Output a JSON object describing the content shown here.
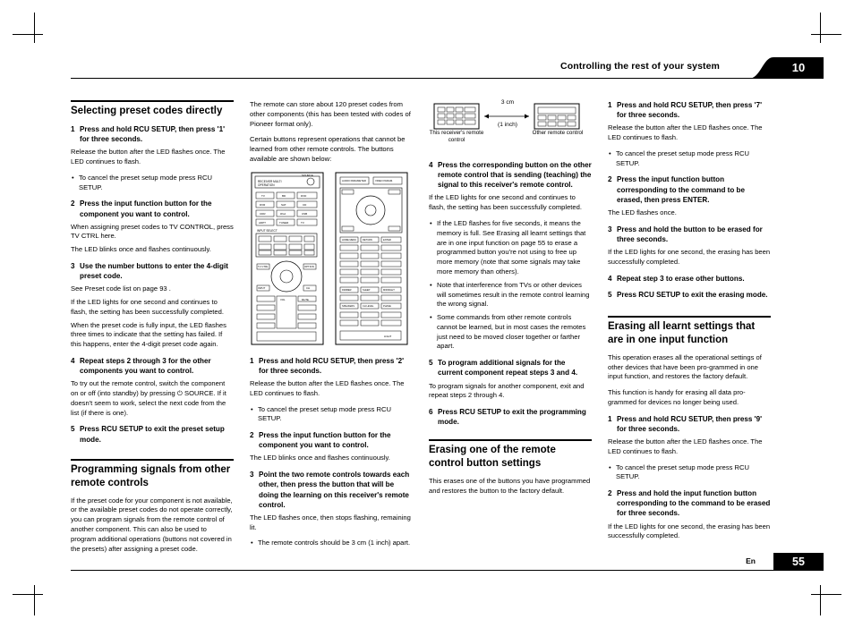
{
  "header": {
    "title": "Controlling the rest of your system",
    "chapter": "10"
  },
  "footer": {
    "lang": "En",
    "page": "55"
  },
  "col1": {
    "heading1": "Selecting preset codes directly",
    "step1_num": "1",
    "step1_text": "Press and hold RCU SETUP, then press '1' for three seconds.",
    "p1": "Release the button after the LED flashes once. The LED continues to flash.",
    "b1": "To cancel the preset setup mode press RCU SETUP.",
    "step2_num": "2",
    "step2_text": "Press the input function button for the component you want to control.",
    "p2": "When assigning preset codes to TV CONTROL, press TV CTRL here.",
    "p3": "The LED blinks once and flashes continuously.",
    "step3_num": "3",
    "step3_text": "Use the number buttons to enter the 4-digit preset code.",
    "p4": "See Preset code list on page 93 .",
    "p5": "If the LED lights for one second and continues to flash, the setting has been successfully completed.",
    "p6": "When the preset code is fully input, the LED flashes three times to indicate that the setting has failed. If this happens, enter the 4-digit preset code again.",
    "step4_num": "4",
    "step4_text": "Repeat steps 2 through 3 for the other components you want to control.",
    "p7": "To try out the remote control, switch the component on or off (into standby) by pressing ⏻ SOURCE. If it doesn't seem to work, select the next code from the list (if there is one).",
    "step5_num": "5",
    "step5_text": "Press RCU SETUP to exit the preset setup mode.",
    "heading2": "Programming signals from other remote controls",
    "p8": "If the preset code for your component is not available, or the available preset codes do not operate correctly, you can program signals from the remote control of another component. This can also be used to program additional operations (buttons not covered in the presets) after assigning a preset code."
  },
  "col2": {
    "p1": "The remote can store about 120 preset codes from other components (this has been tested with codes of Pioneer format only).",
    "p2": "Certain buttons represent operations that cannot be learned from other remote controls. The buttons available are shown below:",
    "step1_num": "1",
    "step1_text": "Press and hold RCU SETUP, then press '2' for three seconds.",
    "p3": "Release the button after the LED flashes once. The LED continues to flash.",
    "b1": "To cancel the preset setup mode press RCU SETUP.",
    "step2_num": "2",
    "step2_text": "Press the input function button for the component you want to control.",
    "p4": "The LED blinks once and flashes continuously.",
    "step3_num": "3",
    "step3_text": "Point the two remote controls towards each other, then press the button that will be doing the learning on this receiver's remote control.",
    "p5": "The LED flashes once, then stops flashing, remaining lit.",
    "b2": "The remote controls should be 3 cm (1 inch) apart."
  },
  "col3": {
    "fig_left_caption": "This receiver's remote control",
    "fig_dim_top": "3 cm",
    "fig_dim_bottom": "(1 inch)",
    "fig_right_caption": "Other remote control",
    "step4_num": "4",
    "step4_text": "Press the corresponding button on the other remote control that is sending (teaching) the signal to this receiver's remote control.",
    "p1": "If the LED lights for one second and continues to flash, the setting has been successfully completed.",
    "b1": "If the LED flashes for five seconds, it means the memory is full. See Erasing all learnt settings that are in one input function on page 55 to erase a programmed button you're not using to free up more memory (note that some signals may take more memory than others).",
    "b2": "Note that interference from TVs or other devices will sometimes result in the remote control learning the wrong signal.",
    "b3": "Some commands from other remote controls cannot be learned, but in most cases the remotes just need to be moved closer together or farther apart.",
    "step5_num": "5",
    "step5_text": "To program additional signals for the current component repeat steps 3 and 4.",
    "p2": "To program signals for another component, exit and repeat steps 2 through 4.",
    "step6_num": "6",
    "step6_text": "Press RCU SETUP to exit the programming mode.",
    "heading1": "Erasing one of the remote control button settings",
    "p3": "This erases one of the buttons you have programmed and restores the button to the factory default."
  },
  "col4": {
    "step1_num": "1",
    "step1_text": "Press and hold RCU SETUP, then press '7' for three seconds.",
    "p1": "Release the button after the LED flashes once. The LED continues to flash.",
    "b1": "To cancel the preset setup mode press RCU SETUP.",
    "step2_num": "2",
    "step2_text": "Press the input function button corresponding to the command to be erased, then press ENTER.",
    "p2": "The LED flashes once.",
    "step3_num": "3",
    "step3_text": "Press and hold the button to be erased for three seconds.",
    "p3": "If the LED lights for one second, the erasing has been successfully completed.",
    "step4_num": "4",
    "step4_text": "Repeat step 3 to erase other buttons.",
    "step5_num": "5",
    "step5_text": "Press RCU SETUP to exit the erasing mode.",
    "heading1": "Erasing all learnt settings that are in one input function",
    "p4": "This operation erases all the operational settings of other devices that have been pro-grammed in one input function, and restores the factory default.",
    "p5": "This function is handy for erasing all data pro-grammed for devices no longer being used.",
    "step6_num": "1",
    "step6_text": "Press and hold RCU SETUP, then press '9' for three seconds.",
    "p6": "Release the button after the LED flashes once. The LED continues to flash.",
    "b2": "To cancel the preset setup mode press RCU SETUP.",
    "step7_num": "2",
    "step7_text": "Press and hold the input function button corresponding to the command to be erased for three seconds.",
    "p7": "If the LED lights for one second, the erasing has been successfully completed."
  },
  "remote_left": {
    "labels": [
      "RECEIVER MULTI",
      "OPERATION",
      "SOURCE",
      "TV",
      "BD",
      "DVD",
      "DVR/BDR",
      "SAT",
      "CD",
      "CDR",
      "iPod",
      "USB",
      "ADPT",
      "TUNER",
      "INPUT SELECT",
      "TV CTRL",
      "OPTION",
      "INPUT",
      "CH",
      "VOL",
      "MUTE"
    ]
  },
  "remote_right": {
    "labels": [
      "AUDIO PARAMETER",
      "VIDEO PARAMETER",
      "HOME MENU",
      "RETURN",
      "ENTER",
      "BAND",
      "TOOLS",
      "SETUP",
      "DIMMER",
      "SLEEP",
      "MIDNIGHT",
      "SPEAKERS",
      "CH LEVEL",
      "S.RETRIEVER",
      "PHASE",
      "LIGHT"
    ]
  }
}
